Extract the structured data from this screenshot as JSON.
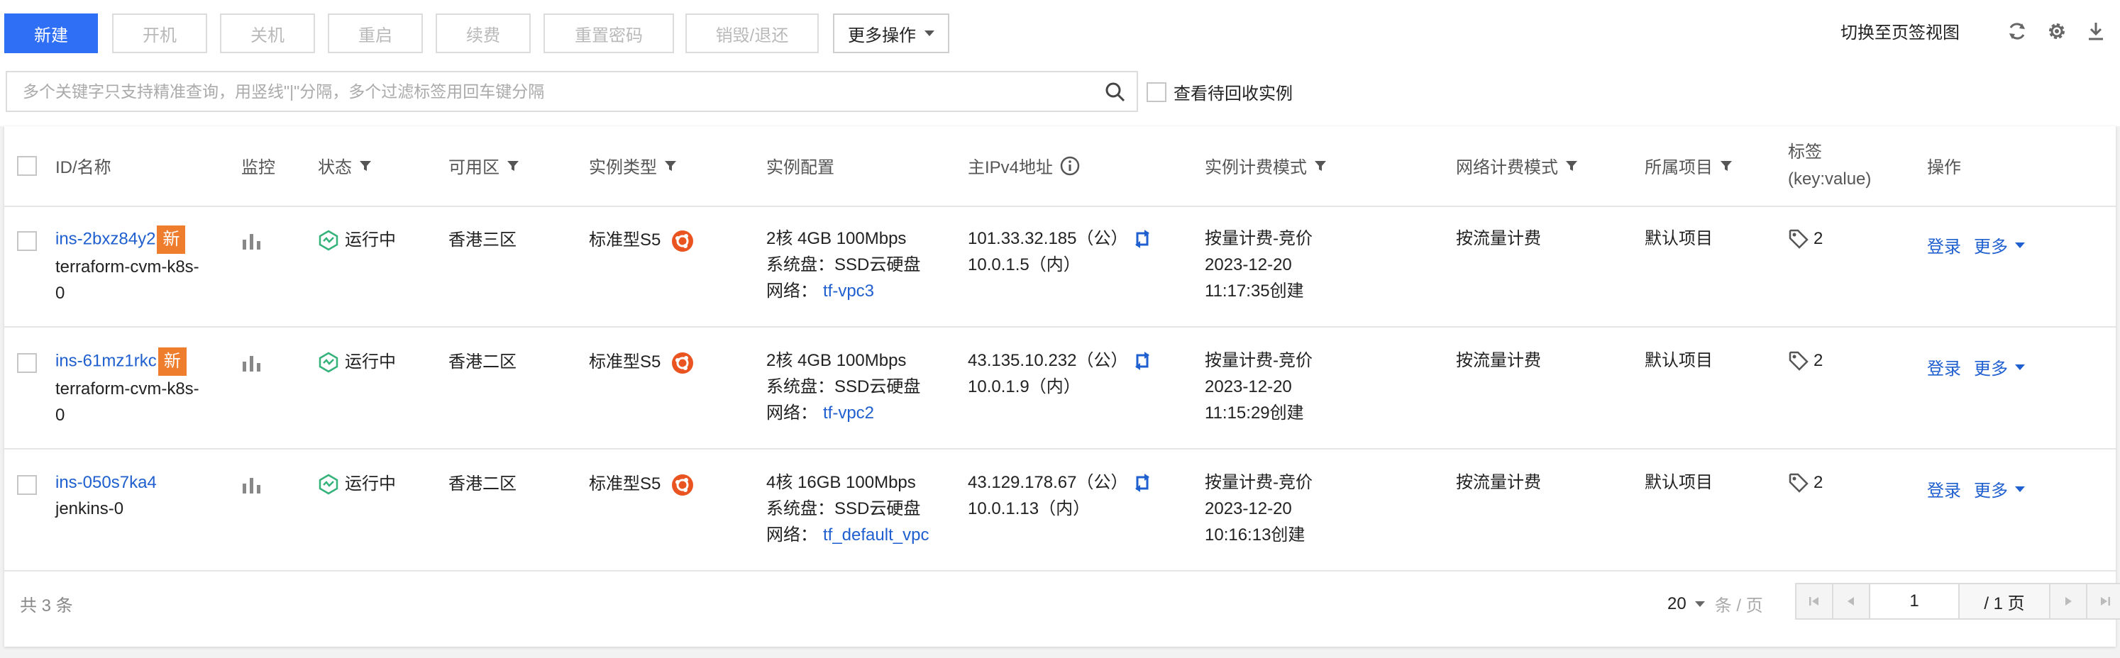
{
  "toolbar": {
    "create": "新建",
    "start": "开机",
    "stop": "关机",
    "restart": "重启",
    "renew": "续费",
    "reset_password": "重置密码",
    "destroy": "销毁/退还",
    "more_actions": "更多操作",
    "switch_view": "切换至页签视图",
    "refresh_icon": "refresh-icon",
    "settings_icon": "gear-icon",
    "download_icon": "download-icon"
  },
  "search": {
    "placeholder": "多个关键字只支持精准查询，用竖线\"|\"分隔，多个过滤标签用回车键分隔",
    "recycle_label": "查看待回收实例"
  },
  "table": {
    "headers": {
      "id_name": "ID/名称",
      "monitor": "监控",
      "status": "状态",
      "zone": "可用区",
      "instance_type": "实例类型",
      "config": "实例配置",
      "ipv4": "主IPv4地址",
      "billing": "实例计费模式",
      "net_billing": "网络计费模式",
      "project": "所属项目",
      "tags_line1": "标签",
      "tags_line2": "(key:value)",
      "ops": "操作"
    },
    "rows": [
      {
        "id": "ins-2bxz84y2",
        "new_badge": "新",
        "name_line1": "terraform-cvm-k8s-",
        "name_line2": "0",
        "status": "运行中",
        "zone": "香港三区",
        "type": "标准型S5",
        "config_line1": "2核 4GB 100Mbps",
        "config_disk": "系统盘：SSD云硬盘",
        "config_net_label": "网络：",
        "config_net": "tf-vpc3",
        "ip_public": "101.33.32.185（公）",
        "ip_private": "10.0.1.5（内）",
        "billing_line1": "按量计费-竞价",
        "billing_line2": "2023-12-20",
        "billing_line3": "11:17:35创建",
        "net_billing": "按流量计费",
        "project": "默认项目",
        "tags": "2",
        "login": "登录",
        "more": "更多"
      },
      {
        "id": "ins-61mz1rkc",
        "new_badge": "新",
        "name_line1": "terraform-cvm-k8s-",
        "name_line2": "0",
        "status": "运行中",
        "zone": "香港二区",
        "type": "标准型S5",
        "config_line1": "2核 4GB 100Mbps",
        "config_disk": "系统盘：SSD云硬盘",
        "config_net_label": "网络：",
        "config_net": "tf-vpc2",
        "ip_public": "43.135.10.232（公）",
        "ip_private": "10.0.1.9（内）",
        "billing_line1": "按量计费-竞价",
        "billing_line2": "2023-12-20",
        "billing_line3": "11:15:29创建",
        "net_billing": "按流量计费",
        "project": "默认项目",
        "tags": "2",
        "login": "登录",
        "more": "更多"
      },
      {
        "id": "ins-050s7ka4",
        "new_badge": "",
        "name_line1": "jenkins-0",
        "name_line2": "",
        "status": "运行中",
        "zone": "香港二区",
        "type": "标准型S5",
        "config_line1": "4核 16GB 100Mbps",
        "config_disk": "系统盘：SSD云硬盘",
        "config_net_label": "网络：",
        "config_net": "tf_default_vpc",
        "ip_public": "43.129.178.67（公）",
        "ip_private": "10.0.1.13（内）",
        "billing_line1": "按量计费-竞价",
        "billing_line2": "2023-12-20",
        "billing_line3": "10:16:13创建",
        "net_billing": "按流量计费",
        "project": "默认项目",
        "tags": "2",
        "login": "登录",
        "more": "更多"
      }
    ]
  },
  "footer": {
    "total": "共 3 条",
    "page_size": "20",
    "per_page_unit": "条 / 页",
    "current_page": "1",
    "total_pages": "/ 1 页"
  }
}
